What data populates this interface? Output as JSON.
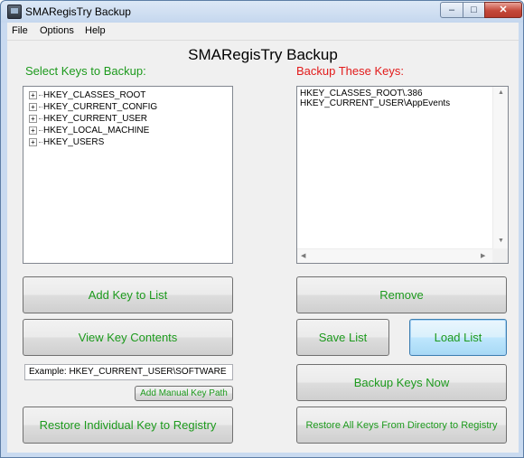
{
  "window": {
    "title": "SMARegisTry Backup",
    "controls": {
      "minimize": "–",
      "maximize": "□",
      "close": "✕"
    }
  },
  "menu": {
    "items": [
      "File",
      "Options",
      "Help"
    ]
  },
  "app_title": "SMARegisTry Backup",
  "left_panel": {
    "label": "Select Keys to Backup:",
    "tree_items": [
      "HKEY_CLASSES_ROOT",
      "HKEY_CURRENT_CONFIG",
      "HKEY_CURRENT_USER",
      "HKEY_LOCAL_MACHINE",
      "HKEY_USERS"
    ],
    "expander_symbol": "+"
  },
  "right_panel": {
    "label": "Backup These Keys:",
    "list_items": [
      "HKEY_CLASSES_ROOT\\.386",
      "HKEY_CURRENT_USER\\AppEvents"
    ]
  },
  "buttons": {
    "add_key": "Add Key to List",
    "remove": "Remove",
    "view_key": "View Key Contents",
    "save_list": "Save List",
    "load_list": "Load List",
    "backup_now": "Backup Keys Now",
    "add_manual": "Add Manual Key Path",
    "restore_individual": "Restore Individual Key to Registry",
    "restore_all": "Restore All Keys From Directory to Registry"
  },
  "manual_path": {
    "value": "Example:  HKEY_CURRENT_USER\\SOFTWARE"
  },
  "colors": {
    "green_text": "#1d9a1d",
    "red_text": "#e21b1b",
    "focus_border": "#3c7fb1"
  },
  "icons": {
    "app": "app-icon",
    "tree_expander": "plus-box-icon"
  }
}
